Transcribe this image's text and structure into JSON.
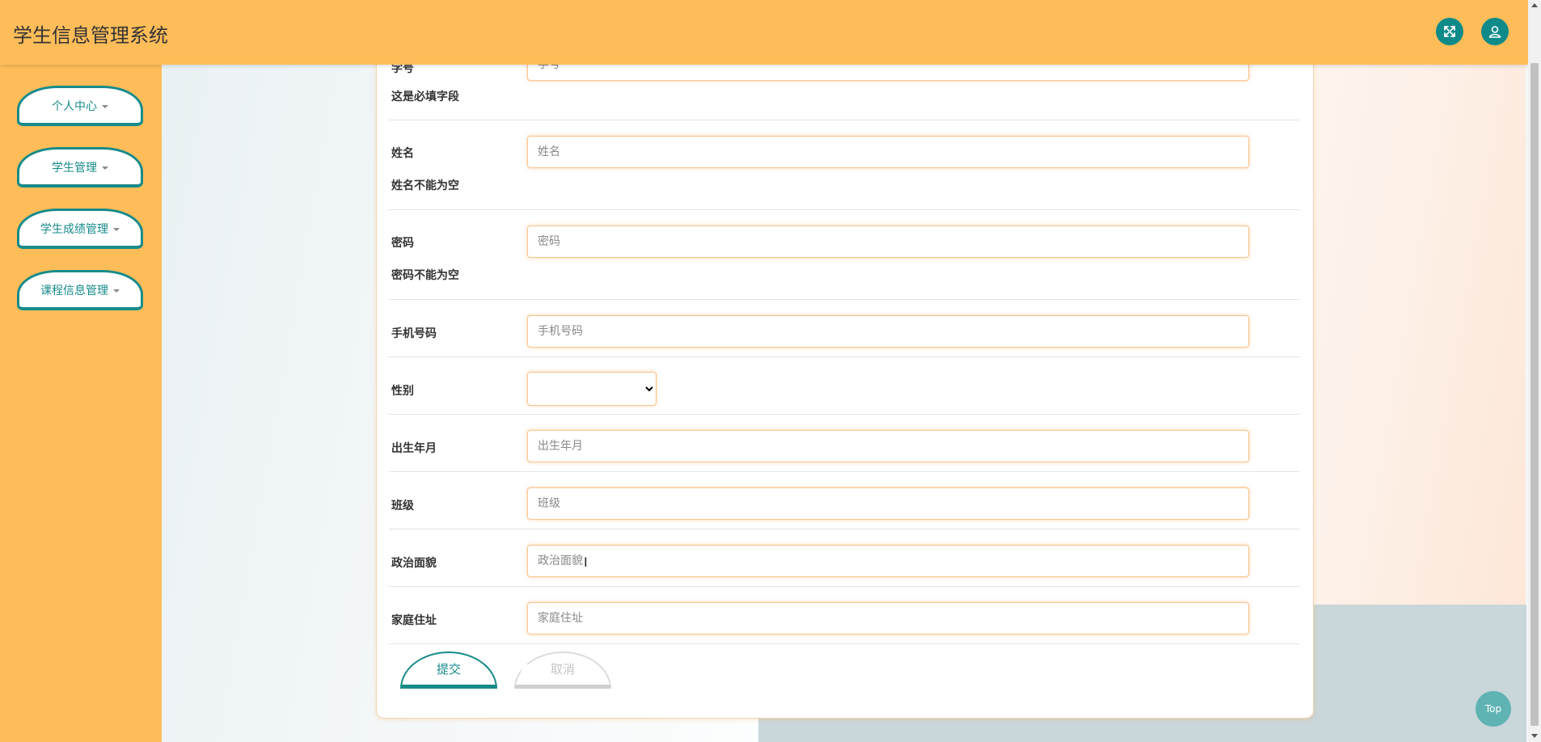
{
  "app": {
    "title": "学生信息管理系统"
  },
  "header": {
    "fullscreen_icon": "fullscreen-icon",
    "user_icon": "user-icon"
  },
  "sidebar": {
    "items": [
      {
        "label": "个人中心"
      },
      {
        "label": "学生管理"
      },
      {
        "label": "学生成绩管理"
      },
      {
        "label": "课程信息管理"
      }
    ]
  },
  "form": {
    "student_no": {
      "label": "学号",
      "placeholder": "学号",
      "hint": "这是必填字段"
    },
    "name": {
      "label": "姓名",
      "placeholder": "姓名",
      "hint": "姓名不能为空"
    },
    "password": {
      "label": "密码",
      "placeholder": "密码",
      "hint": "密码不能为空"
    },
    "phone": {
      "label": "手机号码",
      "placeholder": "手机号码"
    },
    "gender": {
      "label": "性别",
      "value": ""
    },
    "birth": {
      "label": "出生年月",
      "placeholder": "出生年月"
    },
    "class": {
      "label": "班级",
      "placeholder": "班级"
    },
    "politics": {
      "label": "政治面貌",
      "placeholder": "政治面貌"
    },
    "address": {
      "label": "家庭住址",
      "placeholder": "家庭住址"
    }
  },
  "buttons": {
    "submit": "提交",
    "cancel": "取消"
  },
  "back_to_top": "Top",
  "colors": {
    "header_bg": "#ffbd59",
    "accent": "#178b8a",
    "input_border": "#f7c48e"
  }
}
